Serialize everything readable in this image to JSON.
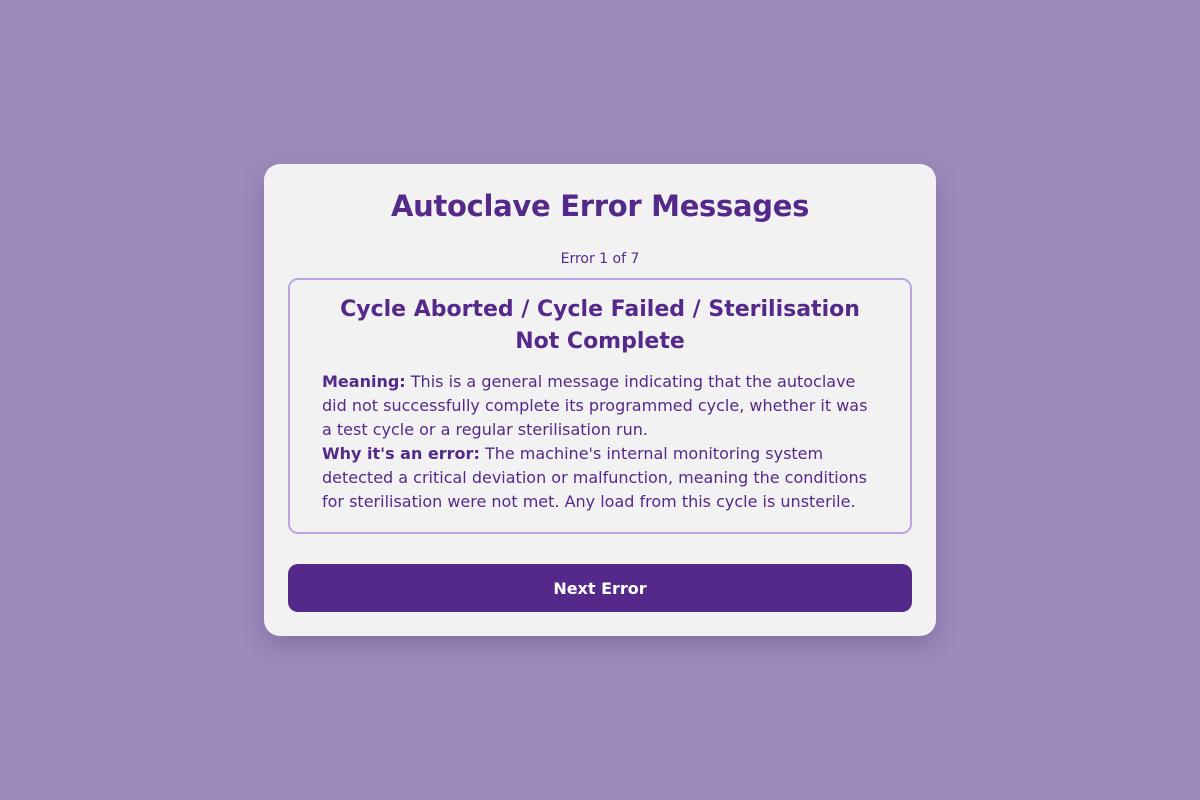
{
  "page": {
    "title": "Autoclave Error Messages",
    "counter": "Error 1 of 7"
  },
  "error": {
    "title": "Cycle Aborted / Cycle Failed / Sterilisation Not Complete",
    "meaning_label": "Meaning:",
    "meaning_text": "This is a general message indicating that the autoclave did not successfully complete its programmed cycle, whether it was a test cycle or a regular sterilisation run.",
    "why_label": "Why it's an error:",
    "why_text": "The machine's internal monitoring system detected a critical deviation or malfunction, meaning the conditions for sterilisation were not met. Any load from this cycle is unsterile."
  },
  "actions": {
    "next_label": "Next Error"
  },
  "colors": {
    "background": "#9e8bbb",
    "card": "#f2f2f2",
    "accent": "#55298a",
    "box_border": "#bba6e0"
  }
}
